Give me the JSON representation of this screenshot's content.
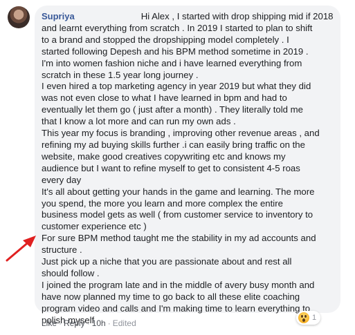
{
  "comment": {
    "author": "Supriya",
    "lines": [
      "Hi Alex , I started with drop shipping mid if 2018",
      "and learnt everything from scratch . In 2019 I started to plan to shift",
      "to a brand and stopped the dropshipping model completely . I",
      "started following Depesh and his BPM method sometime in 2019 .",
      "I'm into women fashion niche and i have learned everything from",
      "scratch in these 1.5 year long journey .",
      "I even hired a top marketing agency in year 2019 but what they did",
      "was not even close to what I have learned in bpm and had to",
      "eventually let them go ( just after a month) . They literally told me",
      "that I know a lot more and can run my own ads .",
      "This year my focus is branding , improving other revenue areas , and",
      "refining my ad buying skills further .i can easily bring traffic on the",
      "website, make good creatives copywriting etc and knows my",
      "audience but I want to refine myself to get to consistent 4-5 roas",
      "every day",
      "It's all about getting your hands in the game and learning. The more",
      "you spend, the more you learn and more complex the entire",
      "business model gets as well ( from customer service to inventory to",
      "customer experience etc )",
      "For sure BPM method taught me the stability in my ad accounts and",
      "structure .",
      "Just pick up a niche that you are passionate about and rest all",
      "should follow .",
      "I joined the program late and in the middle of avery busy month and",
      "have now planned my time to go back to all these elite coaching",
      "program video and calls and I'm making time to learn everything to",
      "polish myself"
    ]
  },
  "actions": {
    "like": "Like",
    "reply": "Reply",
    "time": "10h",
    "edited": "Edited",
    "separator": "·"
  },
  "reaction": {
    "icon": "wow-emoji-icon",
    "count": "1"
  },
  "annotation": {
    "arrow_color": "#e02020"
  }
}
